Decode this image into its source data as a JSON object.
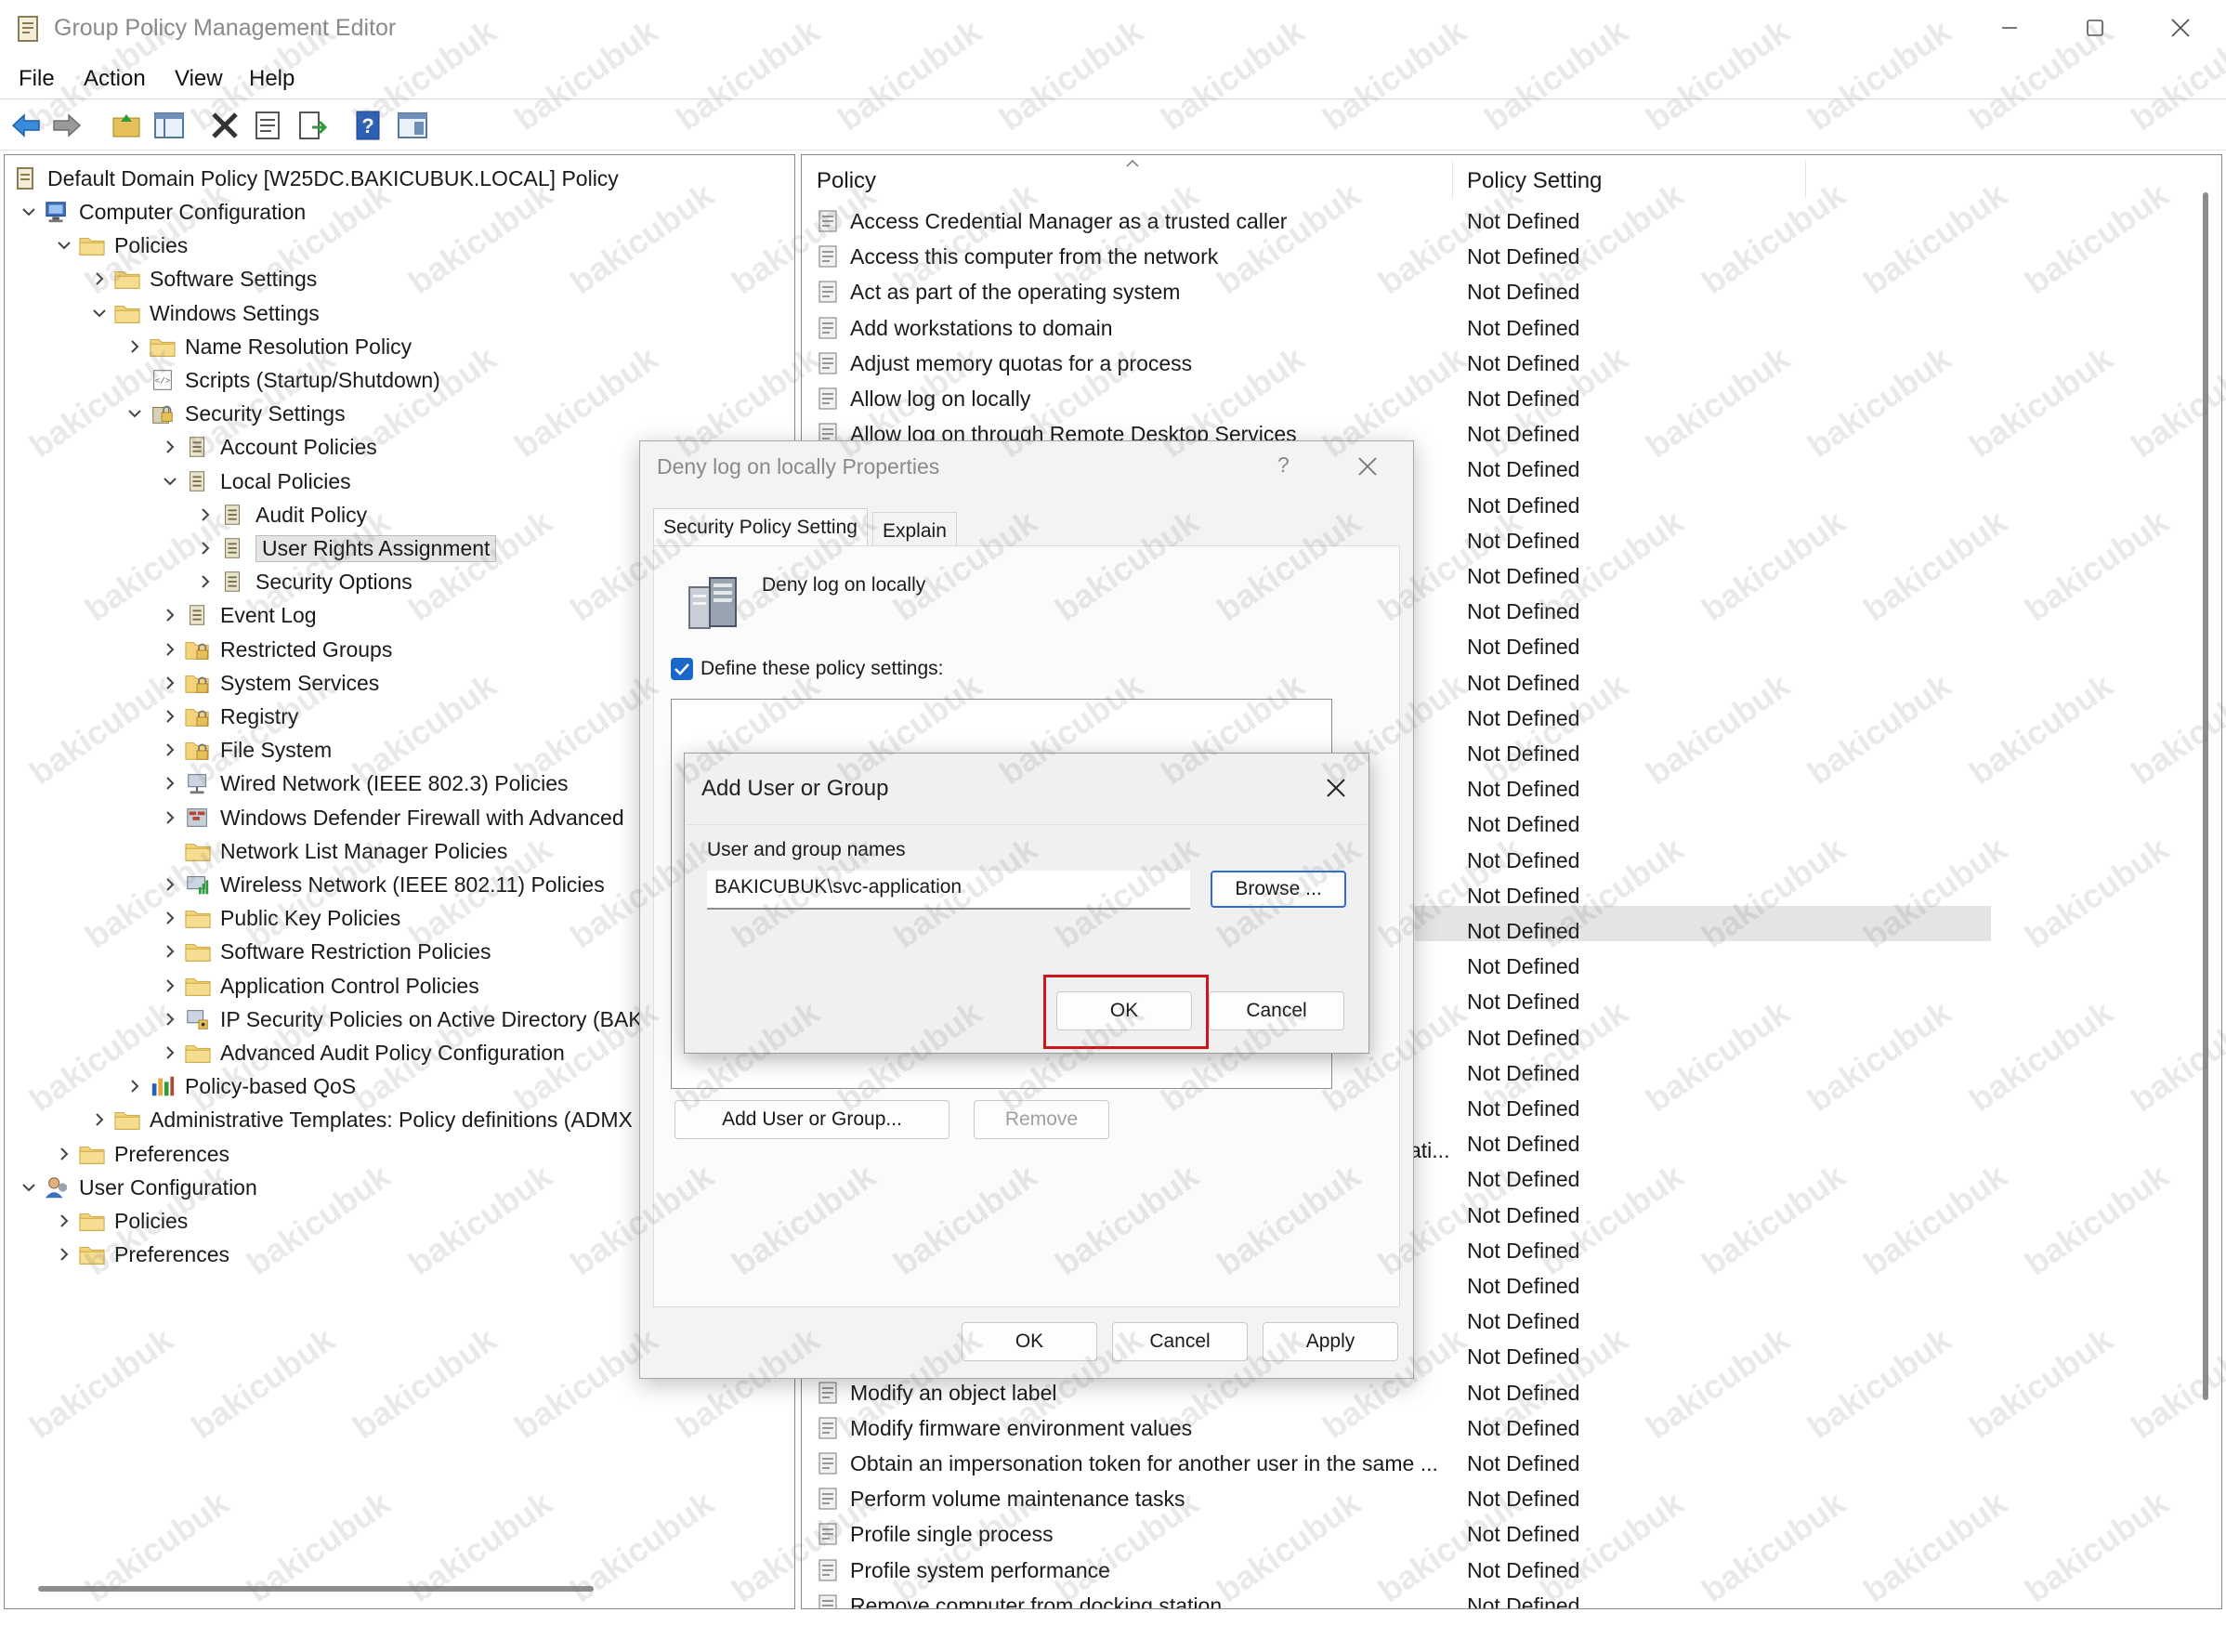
{
  "window": {
    "title": "Group Policy Management Editor"
  },
  "menu": [
    "File",
    "Action",
    "View",
    "Help"
  ],
  "tree": {
    "root": "Default Domain Policy [W25DC.BAKICUBUK.LOCAL] Policy",
    "nodes": [
      {
        "label": "Computer Configuration",
        "level": 0,
        "chev": "open",
        "icon": "computer-icon"
      },
      {
        "label": "Policies",
        "level": 1,
        "chev": "open",
        "icon": "folder-icon"
      },
      {
        "label": "Software Settings",
        "level": 2,
        "chev": "closed",
        "icon": "folder-icon"
      },
      {
        "label": "Windows Settings",
        "level": 2,
        "chev": "open",
        "icon": "folder-icon"
      },
      {
        "label": "Name Resolution Policy",
        "level": 3,
        "chev": "closed",
        "icon": "folder-icon"
      },
      {
        "label": "Scripts (Startup/Shutdown)",
        "level": 3,
        "chev": "none",
        "icon": "script-icon"
      },
      {
        "label": "Security Settings",
        "level": 3,
        "chev": "open",
        "icon": "security-icon"
      },
      {
        "label": "Account Policies",
        "level": 4,
        "chev": "closed",
        "icon": "policy-folder-icon"
      },
      {
        "label": "Local Policies",
        "level": 4,
        "chev": "open",
        "icon": "policy-folder-icon"
      },
      {
        "label": "Audit Policy",
        "level": 5,
        "chev": "closed",
        "icon": "policy-folder-icon"
      },
      {
        "label": "User Rights Assignment",
        "level": 5,
        "chev": "closed",
        "icon": "policy-folder-icon",
        "selected": true
      },
      {
        "label": "Security Options",
        "level": 5,
        "chev": "closed",
        "icon": "policy-folder-icon"
      },
      {
        "label": "Event Log",
        "level": 4,
        "chev": "closed",
        "icon": "policy-folder-icon"
      },
      {
        "label": "Restricted Groups",
        "level": 4,
        "chev": "closed",
        "icon": "lock-folder-icon"
      },
      {
        "label": "System Services",
        "level": 4,
        "chev": "closed",
        "icon": "lock-folder-icon"
      },
      {
        "label": "Registry",
        "level": 4,
        "chev": "closed",
        "icon": "lock-folder-icon"
      },
      {
        "label": "File System",
        "level": 4,
        "chev": "closed",
        "icon": "lock-folder-icon"
      },
      {
        "label": "Wired Network (IEEE 802.3) Policies",
        "level": 4,
        "chev": "closed",
        "icon": "network-icon"
      },
      {
        "label": "Windows Defender Firewall with Advanced",
        "level": 4,
        "chev": "closed",
        "icon": "firewall-icon"
      },
      {
        "label": "Network List Manager Policies",
        "level": 4,
        "chev": "none",
        "icon": "folder-icon"
      },
      {
        "label": "Wireless Network (IEEE 802.11) Policies",
        "level": 4,
        "chev": "closed",
        "icon": "wireless-icon"
      },
      {
        "label": "Public Key Policies",
        "level": 4,
        "chev": "closed",
        "icon": "folder-icon"
      },
      {
        "label": "Software Restriction Policies",
        "level": 4,
        "chev": "closed",
        "icon": "folder-icon"
      },
      {
        "label": "Application Control Policies",
        "level": 4,
        "chev": "closed",
        "icon": "folder-icon"
      },
      {
        "label": "IP Security Policies on Active Directory (BAK",
        "level": 4,
        "chev": "closed",
        "icon": "ipsec-icon"
      },
      {
        "label": "Advanced Audit Policy Configuration",
        "level": 4,
        "chev": "closed",
        "icon": "folder-icon"
      },
      {
        "label": "Policy-based QoS",
        "level": 3,
        "chev": "closed",
        "icon": "chart-icon"
      },
      {
        "label": "Administrative Templates: Policy definitions (ADMX",
        "level": 2,
        "chev": "closed",
        "icon": "folder-icon"
      },
      {
        "label": "Preferences",
        "level": 1,
        "chev": "closed",
        "icon": "folder-icon"
      },
      {
        "label": "User Configuration",
        "level": 0,
        "chev": "open",
        "icon": "user-icon"
      },
      {
        "label": "Policies",
        "level": 1,
        "chev": "closed",
        "icon": "folder-icon"
      },
      {
        "label": "Preferences",
        "level": 1,
        "chev": "closed",
        "icon": "folder-icon"
      }
    ]
  },
  "list": {
    "col_policy": "Policy",
    "col_setting": "Policy Setting",
    "setting_value": "Not Defined",
    "top_rows": [
      "Access Credential Manager as a trusted caller",
      "Access this computer from the network",
      "Act as part of the operating system",
      "Add workstations to domain",
      "Adjust memory quotas for a process",
      "Allow log on locally",
      "Allow log on through Remote Desktop Services"
    ],
    "partial_text": "ati...",
    "bottom_rows": [
      "Modify an object label",
      "Modify firmware environment values",
      "Obtain an impersonation token for another user in the same ...",
      "Perform volume maintenance tasks",
      "Profile single process",
      "Profile system performance",
      "Remove computer from docking station"
    ]
  },
  "properties_dialog": {
    "title": "Deny log on locally Properties",
    "help": "?",
    "tab_security": "Security Policy Setting",
    "tab_explain": "Explain",
    "policy_name": "Deny log on locally",
    "define_label": "Define these policy settings:",
    "add_user_btn": "Add User or Group...",
    "remove_btn": "Remove",
    "ok": "OK",
    "cancel": "Cancel",
    "apply": "Apply"
  },
  "add_dialog": {
    "title": "Add User or Group",
    "field_label": "User and group names",
    "field_value": "BAKICUBUK\\svc-application",
    "browse": "Browse ...",
    "ok": "OK",
    "cancel": "Cancel"
  },
  "watermark": "bakicubuk",
  "colors": {
    "highlight_red": "#d0141b",
    "checkbox_blue": "#1a67c9",
    "folder_yellow": "#e8c05a"
  }
}
